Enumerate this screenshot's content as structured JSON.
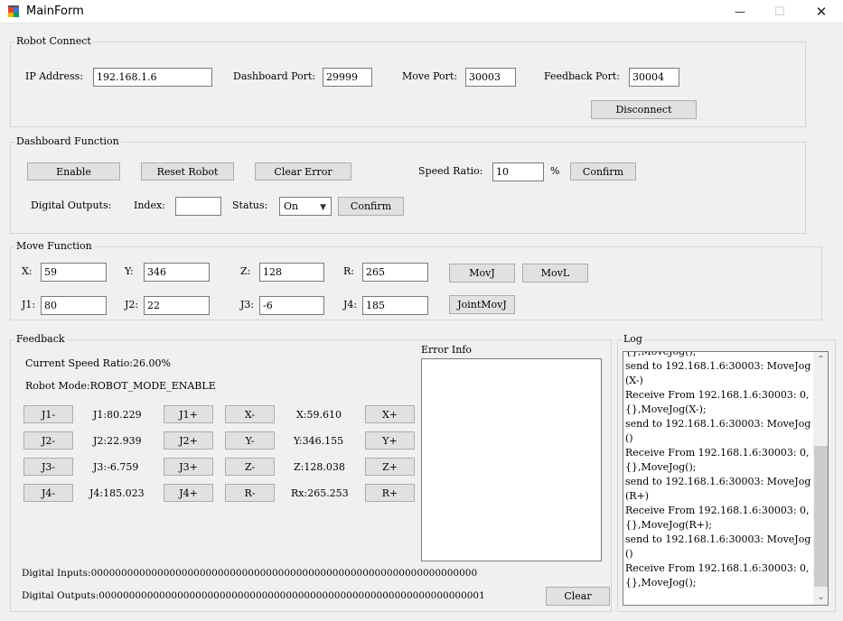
{
  "window": {
    "title": "MainForm",
    "minimize": "—",
    "maximize": "☐",
    "close": "✕"
  },
  "robot_connect": {
    "title": "Robot Connect",
    "ip_label": "IP Address:",
    "ip_value": "192.168.1.6",
    "dash_port_label": "Dashboard Port:",
    "dash_port_value": "29999",
    "move_port_label": "Move Port:",
    "move_port_value": "30003",
    "feedback_port_label": "Feedback Port:",
    "feedback_port_value": "30004",
    "disconnect": "Disconnect"
  },
  "dashboard": {
    "title": "Dashboard Function",
    "enable": "Enable",
    "reset_robot": "Reset Robot",
    "clear_error": "Clear Error",
    "speed_ratio_label": "Speed Ratio:",
    "speed_ratio_value": "10",
    "percent": "%",
    "confirm": "Confirm",
    "digital_outputs_label": "Digital Outputs:",
    "index_label": "Index:",
    "index_value": "",
    "status_label": "Status:",
    "status_value": "On",
    "confirm2": "Confirm"
  },
  "move": {
    "title": "Move Function",
    "x_label": "X:",
    "x_value": "59",
    "y_label": "Y:",
    "y_value": "346",
    "z_label": "Z:",
    "z_value": "128",
    "r_label": "R:",
    "r_value": "265",
    "movj": "MovJ",
    "movl": "MovL",
    "j1_label": "J1:",
    "j1_value": "80",
    "j2_label": "J2:",
    "j2_value": "22",
    "j3_label": "J3:",
    "j3_value": "-6",
    "j4_label": "J4:",
    "j4_value": "185",
    "jointmovj": "JointMovJ"
  },
  "feedback": {
    "title": "Feedback",
    "speed_ratio": "Current Speed Ratio:26.00%",
    "robot_mode": "Robot Mode:ROBOT_MODE_ENABLE",
    "error_info_label": "Error Info",
    "rows": [
      {
        "minus": "J1-",
        "value": "J1:80.229",
        "plus": "J1+",
        "cminus": "X-",
        "cvalue": "X:59.610",
        "cplus": "X+"
      },
      {
        "minus": "J2-",
        "value": "J2:22.939",
        "plus": "J2+",
        "cminus": "Y-",
        "cvalue": "Y:346.155",
        "cplus": "Y+"
      },
      {
        "minus": "J3-",
        "value": "J3:-6.759",
        "plus": "J3+",
        "cminus": "Z-",
        "cvalue": "Z:128.038",
        "cplus": "Z+"
      },
      {
        "minus": "J4-",
        "value": "J4:185.023",
        "plus": "J4+",
        "cminus": "R-",
        "cvalue": "Rx:265.253",
        "cplus": "R+"
      }
    ],
    "digital_inputs": "Digital Inputs:0000000000000000000000000000000000000000000000000000000000000000",
    "digital_outputs": "Digital Outputs:0000000000000000000000000000000000000000000000000000000000000001",
    "clear": "Clear"
  },
  "log": {
    "title": "Log",
    "lines": [
      "{},MoveJog();",
      "send to 192.168.1.6:30003: MoveJog",
      "(X-)",
      "Receive From 192.168.1.6:30003: 0,",
      "{},MoveJog(X-);",
      "send to 192.168.1.6:30003: MoveJog",
      "()",
      "Receive From 192.168.1.6:30003: 0,",
      "{},MoveJog();",
      "send to 192.168.1.6:30003: MoveJog",
      "(R+)",
      "Receive From 192.168.1.6:30003: 0,",
      "{},MoveJog(R+);",
      "send to 192.168.1.6:30003: MoveJog",
      "()",
      "Receive From 192.168.1.6:30003: 0,",
      "{},MoveJog();"
    ]
  }
}
